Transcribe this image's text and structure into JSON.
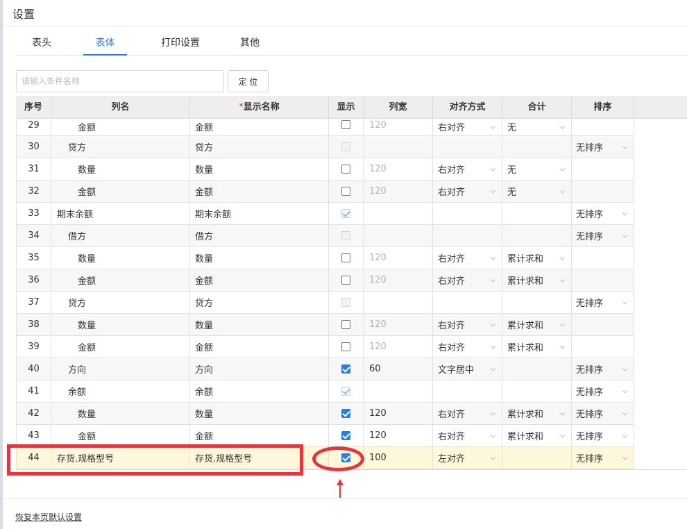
{
  "dialog": {
    "title": "设置"
  },
  "tabs": [
    {
      "label": "表头",
      "active": false
    },
    {
      "label": "表体",
      "active": true
    },
    {
      "label": "打印设置",
      "active": false
    },
    {
      "label": "其他",
      "active": false
    }
  ],
  "search": {
    "placeholder": "请输入条件名称",
    "value": ""
  },
  "locate_button": "定 位",
  "columns": {
    "index": "序号",
    "column_name": "列名",
    "required_mark": "*",
    "display_name": "显示名称",
    "show": "显示",
    "width": "列宽",
    "alignment": "对齐方式",
    "total": "合计",
    "sort": "排序"
  },
  "rows": [
    {
      "index": "29",
      "name": "金额",
      "indent": 2,
      "display": "金额",
      "show": "unchecked",
      "width": "120",
      "width_muted": true,
      "align": "右对齐",
      "total": "无",
      "sort": ""
    },
    {
      "index": "30",
      "name": "贷方",
      "indent": 1,
      "display": "贷方",
      "show": "disabled",
      "width": "",
      "width_muted": false,
      "align": "",
      "total": "",
      "sort": "无排序"
    },
    {
      "index": "31",
      "name": "数量",
      "indent": 2,
      "display": "数量",
      "show": "unchecked",
      "width": "120",
      "width_muted": true,
      "align": "右对齐",
      "total": "无",
      "sort": ""
    },
    {
      "index": "32",
      "name": "金额",
      "indent": 2,
      "display": "金额",
      "show": "unchecked",
      "width": "120",
      "width_muted": true,
      "align": "右对齐",
      "total": "无",
      "sort": ""
    },
    {
      "index": "33",
      "name": "期末余额",
      "indent": 0,
      "display": "期末余额",
      "show": "checked-disabled",
      "width": "",
      "width_muted": false,
      "align": "",
      "total": "",
      "sort": "无排序"
    },
    {
      "index": "34",
      "name": "借方",
      "indent": 1,
      "display": "借方",
      "show": "disabled",
      "width": "",
      "width_muted": false,
      "align": "",
      "total": "",
      "sort": "无排序"
    },
    {
      "index": "35",
      "name": "数量",
      "indent": 2,
      "display": "数量",
      "show": "unchecked",
      "width": "120",
      "width_muted": true,
      "align": "右对齐",
      "total": "累计求和",
      "sort": ""
    },
    {
      "index": "36",
      "name": "金额",
      "indent": 2,
      "display": "金额",
      "show": "unchecked",
      "width": "120",
      "width_muted": true,
      "align": "右对齐",
      "total": "累计求和",
      "sort": ""
    },
    {
      "index": "37",
      "name": "贷方",
      "indent": 1,
      "display": "贷方",
      "show": "disabled",
      "width": "",
      "width_muted": false,
      "align": "",
      "total": "",
      "sort": "无排序"
    },
    {
      "index": "38",
      "name": "数量",
      "indent": 2,
      "display": "数量",
      "show": "unchecked",
      "width": "120",
      "width_muted": true,
      "align": "右对齐",
      "total": "累计求和",
      "sort": ""
    },
    {
      "index": "39",
      "name": "金额",
      "indent": 2,
      "display": "金额",
      "show": "unchecked",
      "width": "120",
      "width_muted": true,
      "align": "右对齐",
      "total": "累计求和",
      "sort": ""
    },
    {
      "index": "40",
      "name": "方向",
      "indent": 1,
      "display": "方向",
      "show": "checked",
      "width": "60",
      "width_muted": false,
      "align": "文字居中",
      "total": "",
      "sort": "无排序"
    },
    {
      "index": "41",
      "name": "余额",
      "indent": 1,
      "display": "余额",
      "show": "checked-disabled",
      "width": "",
      "width_muted": false,
      "align": "",
      "total": "",
      "sort": "无排序"
    },
    {
      "index": "42",
      "name": "数量",
      "indent": 2,
      "display": "数量",
      "show": "checked",
      "width": "120",
      "width_muted": false,
      "align": "右对齐",
      "total": "累计求和",
      "sort": "无排序"
    },
    {
      "index": "43",
      "name": "金额",
      "indent": 2,
      "display": "金额",
      "show": "checked",
      "width": "120",
      "width_muted": false,
      "align": "右对齐",
      "total": "累计求和",
      "sort": "无排序"
    },
    {
      "index": "44",
      "name": "存货.规格型号",
      "indent": 0,
      "display": "存货.规格型号",
      "show": "checked",
      "width": "100",
      "width_muted": false,
      "align": "左对齐",
      "total": "",
      "sort": "无排序",
      "highlight": true
    }
  ],
  "reset_link": "恢复本页默认设置",
  "colors": {
    "accent": "#2d7be5",
    "annotation": "#e8343a",
    "highlight_row": "#fdf7dc"
  }
}
